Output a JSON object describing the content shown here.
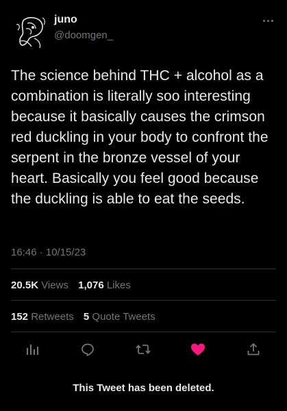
{
  "author": {
    "display_name": "juno",
    "handle": "@doomgen_"
  },
  "tweet": {
    "text": "The science behind THC + alcohol as a combination is literally soo interesting because it basically causes the crimson red duckling in your body to confront the serpent in the bronze vessel of your heart. Basically you feel good because the duckling is able to eat the seeds.",
    "timestamp": "16:46 · 10/15/23"
  },
  "stats": {
    "views_count": "20.5K",
    "views_label": "Views",
    "likes_count": "1,076",
    "likes_label": "Likes",
    "retweets_count": "152",
    "retweets_label": "Retweets",
    "quotes_count": "5",
    "quotes_label": "Quote Tweets"
  },
  "actions": {
    "icons": [
      "analytics-icon",
      "reply-icon",
      "retweet-icon",
      "like-icon",
      "share-icon"
    ],
    "like_color": "#f91880"
  },
  "notice": "This Tweet has been deleted."
}
